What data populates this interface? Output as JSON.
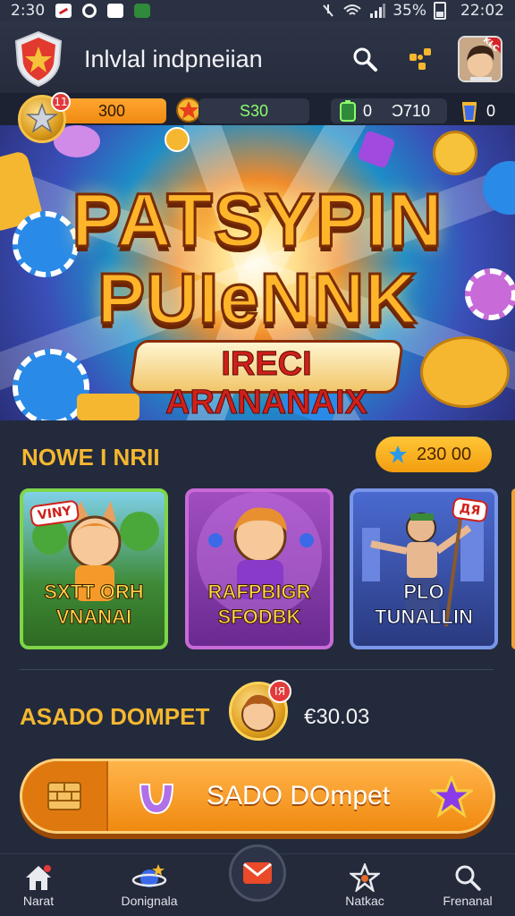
{
  "status_bar": {
    "time": "2:30",
    "battery": "35%",
    "clock": "22:02"
  },
  "header": {
    "title": "Inlvlal indpneiian",
    "avatar_badge": "KLC",
    "icons": [
      "shield-star-icon",
      "search-icon",
      "puzzle-icon",
      "avatar"
    ]
  },
  "currency": {
    "level_badge": "11",
    "coins": "300",
    "gems": "S30",
    "energy_left": "0",
    "energy_right": "Ɔ710",
    "potion": "0"
  },
  "hero": {
    "line1": "PATSYPIN",
    "line2": "PUIeNNK",
    "subtitle": "IRECI ARΛNANAIX"
  },
  "section": {
    "title": "NOWE I NRII",
    "score": "230 00"
  },
  "cards": [
    {
      "tag": "VINY",
      "label": "SXTT ORH VNANAI"
    },
    {
      "tag": "",
      "label": "RAFPBIGR SFODBK"
    },
    {
      "tag": "ДЯ",
      "label": "PLO TUNALLIN"
    }
  ],
  "wallet": {
    "label": "ASADO DOMPET",
    "coin_badge": "IЯ",
    "amount": "€30.03"
  },
  "cta": {
    "label": "SADO DOmpet"
  },
  "nav": {
    "items": [
      {
        "label": "Narat",
        "icon": "home-icon"
      },
      {
        "label": "Donignala",
        "icon": "planet-icon"
      },
      {
        "label": "",
        "icon": "mail-icon"
      },
      {
        "label": "Natkac",
        "icon": "star-icon"
      },
      {
        "label": "Frenanal",
        "icon": "search-icon"
      }
    ]
  },
  "colors": {
    "accent_gold": "#f5b730",
    "cta_orange": "#f08a10",
    "background": "#232a3b"
  }
}
